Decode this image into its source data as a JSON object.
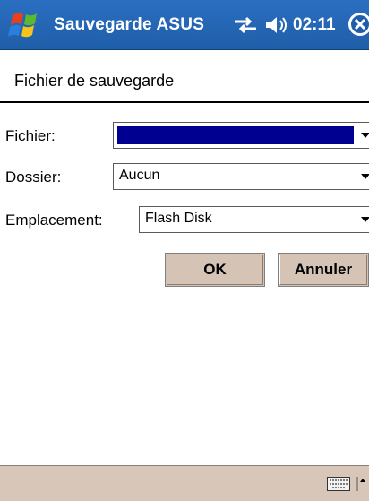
{
  "titlebar": {
    "title": "Sauvegarde ASUS",
    "time": "02:11",
    "icons": [
      "windows-start-icon",
      "connectivity-icon",
      "volume-icon",
      "close-icon"
    ]
  },
  "header": {
    "title": "Fichier de sauvegarde"
  },
  "form": {
    "fichier": {
      "label": "Fichier:",
      "value": ""
    },
    "dossier": {
      "label": "Dossier:",
      "value": "Aucun"
    },
    "emplacement": {
      "label": "Emplacement:",
      "value": "Flash Disk"
    }
  },
  "buttons": {
    "ok": "OK",
    "cancel": "Annuler"
  },
  "colors": {
    "titlebar": "#1f5ea8",
    "selection": "#000090",
    "button_face": "#d5c4b6",
    "bottombar": "#d8c7b9"
  }
}
